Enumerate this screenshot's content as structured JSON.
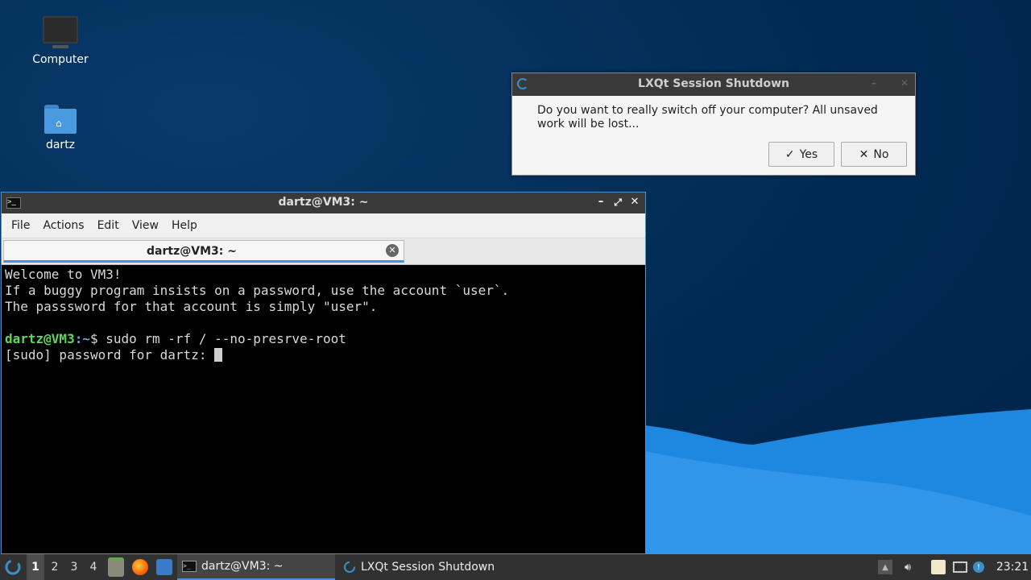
{
  "desktop": {
    "icons": [
      {
        "label": "Computer",
        "icon": "monitor-icon"
      },
      {
        "label": "dartz",
        "icon": "home-folder-icon"
      }
    ]
  },
  "terminal": {
    "title": "dartz@VM3: ~",
    "menu": [
      "File",
      "Actions",
      "Edit",
      "View",
      "Help"
    ],
    "tab_label": "dartz@VM3: ~",
    "lines": [
      "Welcome to VM3!",
      "If a buggy program insists on a password, use the account `user`.",
      "The passsword for that account is simply \"user\"."
    ],
    "prompt_user": "dartz@VM3",
    "prompt_path": ":~",
    "prompt_cmd": "$ sudo rm -rf / --no-presrve-root",
    "sudo_prompt": "[sudo] password for dartz: "
  },
  "dialog": {
    "title": "LXQt Session Shutdown",
    "message": "Do you want to really switch off your computer? All unsaved work will be lost...",
    "yes_label": "Yes",
    "no_label": "No"
  },
  "taskbar": {
    "workspaces": [
      "1",
      "2",
      "3",
      "4"
    ],
    "active_workspace": "1",
    "tasks": [
      {
        "label": "dartz@VM3: ~",
        "active": true
      },
      {
        "label": "LXQt Session Shutdown",
        "active": false
      }
    ],
    "clock": "23:21"
  },
  "colors": {
    "accent": "#4a90d9",
    "prompt_green": "#5fd75f",
    "prompt_blue": "#6fa8dc",
    "wave": "#1a8fe6"
  }
}
